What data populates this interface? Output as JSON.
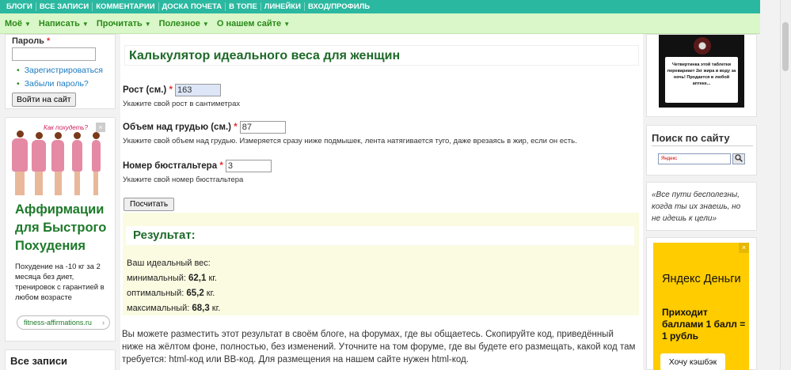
{
  "topnav": [
    "БЛОГИ",
    "ВСЕ ЗАПИСИ",
    "КОММЕНТАРИИ",
    "ДОСКА ПОЧЕТА",
    "В ТОПЕ",
    "ЛИНЕЙКИ",
    "ВХОД/ПРОФИЛЬ"
  ],
  "subnav": [
    "Моё",
    "Написать",
    "Прочитать",
    "Полезное",
    "О нашем сайте"
  ],
  "login": {
    "password_label": "Пароль",
    "required_mark": "*",
    "register_link": "Зарегистрироваться",
    "forgot_link": "Забыли пароль?",
    "login_button": "Войти на сайт"
  },
  "left_ad": {
    "bubble": "Как похудеть?",
    "close": "×",
    "title": "Аффирмации для Быстрого Похудения",
    "text": "Похудение на -10 кг за 2 месяца без диет, тренировок с гарантией в любом возрасте",
    "link": "fitness-affirmations.ru",
    "link_arrow": "›"
  },
  "all_posts": {
    "title": "Все записи"
  },
  "calculator": {
    "title": "Калькулятор идеального веса для женщин",
    "height_label": "Рост (см.)",
    "height_value": "163",
    "height_hint": "Укажите свой рост в сантиметрах",
    "chest_label": "Объем над грудью (см.)",
    "chest_value": "87",
    "chest_hint": "Укажите свой объем над грудью. Измеряется сразу ниже подмышек, лента натягивается туго, даже врезаясь в жир, если он есть.",
    "bra_label": "Номер бюстгальтера",
    "bra_value": "3",
    "bra_hint": "Укажите свой номер бюстгальтера",
    "submit": "Посчитать"
  },
  "result": {
    "title": "Результат:",
    "intro": "Ваш идеальный вес:",
    "min_label": "минимальный:",
    "min_value": "62,1",
    "opt_label": "оптимальный:",
    "opt_value": "65,2",
    "max_label": "максимальный:",
    "max_value": "68,3",
    "unit": "кг."
  },
  "share_text": "Вы можете разместить этот результат в своём блоге, на форумах, где вы общаетесь. Скопируйте код, приведённый ниже на жёлтом фоне, полностью, без изменений. Уточните на том форуме, где вы будете его размещать, какой код там требуется: html-код или BB-код. Для размещения на нашем сайте нужен html-код.",
  "right_ad": {
    "text": "Четвертинка этой таблетки перевариает 2кг жира в воду за ночь! Продается в любой аптеке..."
  },
  "search": {
    "title": "Поиск по сайту",
    "placeholder": "Яндекс",
    "button_icon": "magnifier-icon"
  },
  "quote": "«Все пути бесполезны, когда ты их знаешь, но не идешь к цели»",
  "yandex_ad": {
    "logo": "Яндекс Деньги",
    "close": "×",
    "text": "Приходит баллами 1 балл = 1 рубль",
    "button": "Хочу кэшбэк"
  },
  "colors": {
    "topnav_bg": "#2bb8a0",
    "subnav_bg": "#d9f7c8",
    "heading_green": "#1e6a2a",
    "result_bg": "#fbfbe2",
    "yandex_yellow": "#ffcc00"
  }
}
